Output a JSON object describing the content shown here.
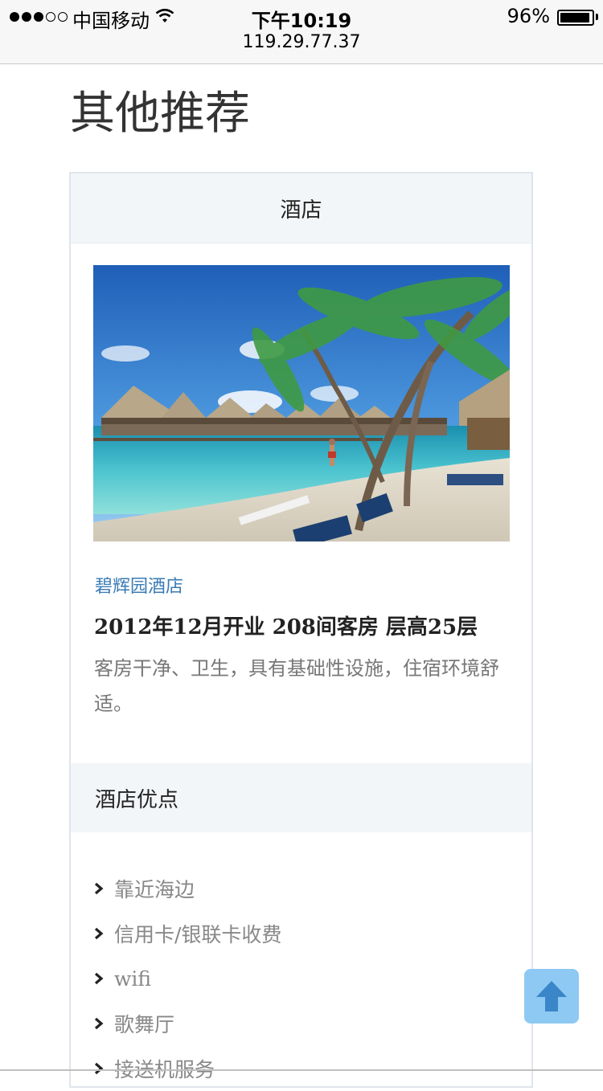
{
  "status_bar": {
    "carrier": "中国移动",
    "time": "下午10:19",
    "battery_percent": "96%",
    "battery_level": 0.96,
    "signal_bars": 3,
    "signal_total": 5
  },
  "address_bar": {
    "url": "119.29.77.37"
  },
  "page": {
    "title": "其他推荐"
  },
  "panel": {
    "heading": "酒店",
    "image_icon": "beach-hotel-photo",
    "hotel_name": "碧辉园酒店",
    "hotel_meta": "2012年12月开业 208间客房 层高25层",
    "hotel_desc": "客房干净、卫生，具有基础性设施，住宿环境舒适。",
    "advantages_heading": "酒店优点",
    "advantages": [
      "靠近海边",
      "信用卡/银联卡收费",
      "wifi",
      "歌舞厅",
      "接送机服务"
    ]
  },
  "back_to_top": {
    "icon": "arrow-up-icon"
  },
  "colors": {
    "link": "#3a7bb5",
    "panel_header": "#f3f6f9",
    "back_top": "#8ec9f3"
  }
}
